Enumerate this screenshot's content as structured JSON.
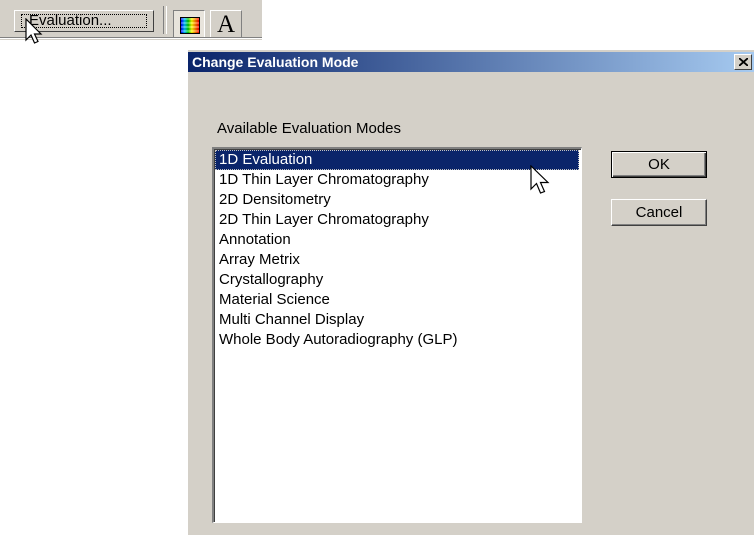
{
  "toolbar": {
    "evaluation_button_label": "Evaluation...",
    "color_tool": "color-palette-icon",
    "text_tool_label": "A"
  },
  "dialog": {
    "title": "Change Evaluation Mode",
    "group_label": "Available Evaluation Modes",
    "modes": [
      "1D Evaluation",
      "1D Thin Layer Chromatography",
      "2D Densitometry",
      "2D Thin Layer Chromatography",
      "Annotation",
      "Array Metrix",
      "Crystallography",
      "Material Science",
      "Multi Channel Display",
      "Whole Body Autoradiography (GLP)"
    ],
    "selected_index": 0,
    "ok_label": "OK",
    "cancel_label": "Cancel"
  },
  "colors": {
    "title_start": "#0a246a",
    "title_end": "#a6caf0",
    "selection": "#0a246a",
    "face": "#d4d0c8"
  }
}
